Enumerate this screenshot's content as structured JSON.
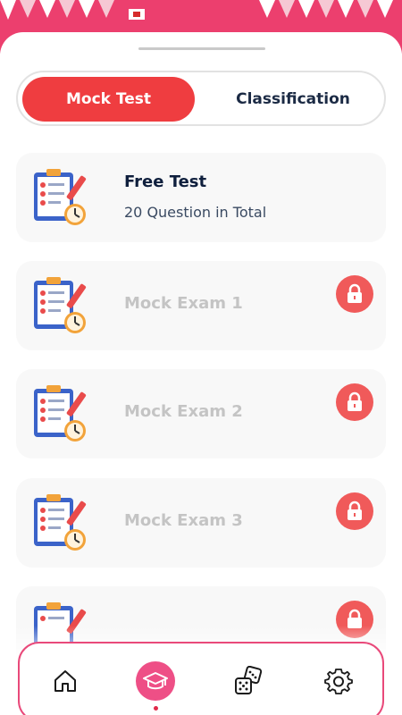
{
  "colors": {
    "accent": "#ef3d40",
    "banner": "#ec3f6e",
    "nav_border": "#e9497a",
    "lock": "#f05a5a"
  },
  "segmented": {
    "tabs": [
      {
        "label": "Mock Test",
        "active": true
      },
      {
        "label": "Classification",
        "active": false
      }
    ]
  },
  "cards": [
    {
      "title": "Free Test",
      "subtitle": "20 Question in Total",
      "locked": false,
      "icon": "clipboard-checklist-icon"
    },
    {
      "title": "Mock Exam 1",
      "locked": true,
      "icon": "clipboard-checklist-icon"
    },
    {
      "title": "Mock Exam 2",
      "locked": true,
      "icon": "clipboard-checklist-icon"
    },
    {
      "title": "Mock Exam 3",
      "locked": true,
      "icon": "clipboard-checklist-icon"
    },
    {
      "title": "",
      "locked": true,
      "icon": "clipboard-checklist-icon"
    }
  ],
  "bottom_nav": {
    "items": [
      {
        "icon": "home-icon",
        "active": false
      },
      {
        "icon": "graduation-cap-icon",
        "active": true
      },
      {
        "icon": "dice-icon",
        "active": false
      },
      {
        "icon": "gear-icon",
        "active": false
      }
    ]
  }
}
